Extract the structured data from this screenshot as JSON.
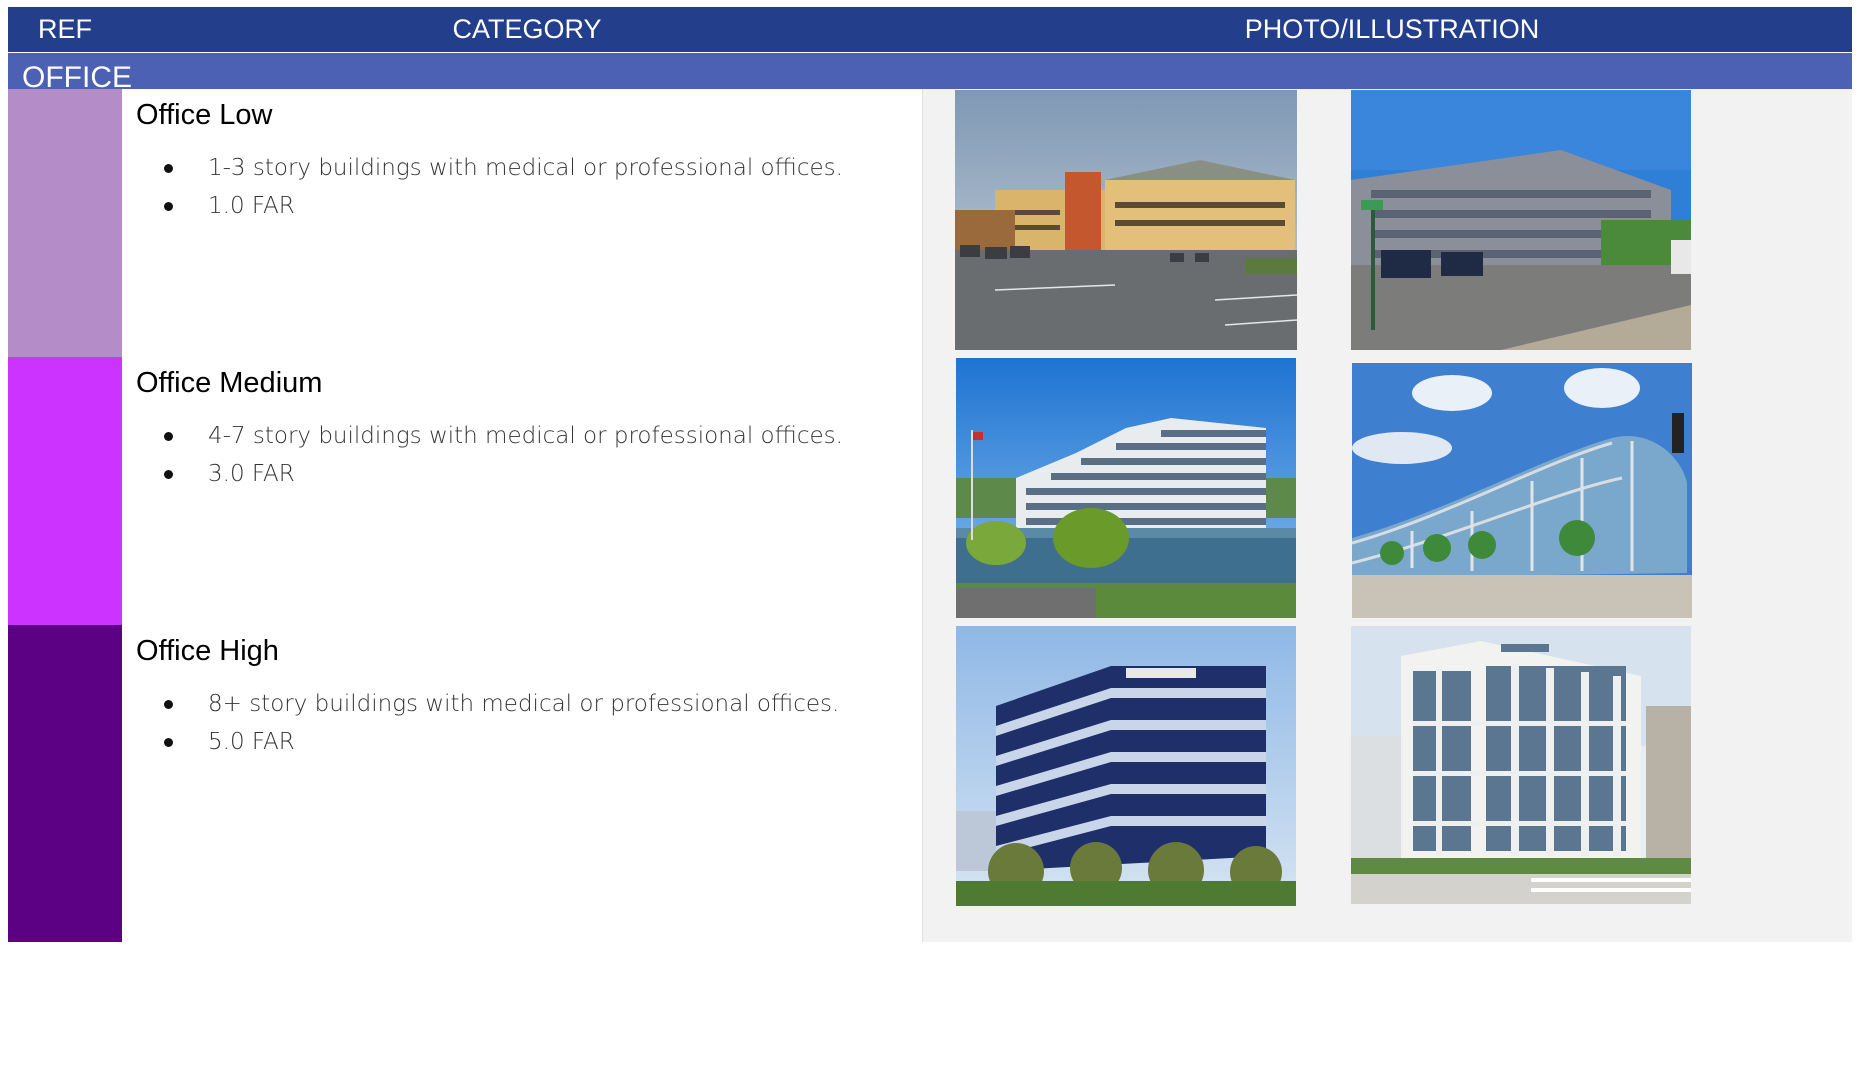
{
  "header": {
    "ref": "REF",
    "category": "CATEGORY",
    "photo": "PHOTO/ILLUSTRATION"
  },
  "section": {
    "label": "OFFICE"
  },
  "rows": [
    {
      "color": "#b48cc8",
      "title": "Office Low",
      "bullets": [
        "1-3 story buildings with medical or professional offices.",
        "1.0 FAR"
      ],
      "photos": [
        "low-rise office photo with parking lot",
        "low-rise office photo at intersection"
      ]
    },
    {
      "color": "#cc33ff",
      "title": "Office Medium",
      "bullets": [
        "4-7 story buildings with medical or professional offices.",
        "3.0 FAR"
      ],
      "photos": [
        "mid-rise office photo by lagoon",
        "curved glass office photo"
      ]
    },
    {
      "color": "#5c0084",
      "title": "Office High",
      "bullets": [
        "8+ story buildings with medical or professional offices.",
        "5.0 FAR"
      ],
      "photos": [
        "high-rise striped office photo",
        "high-rise glass office rendering"
      ]
    }
  ]
}
